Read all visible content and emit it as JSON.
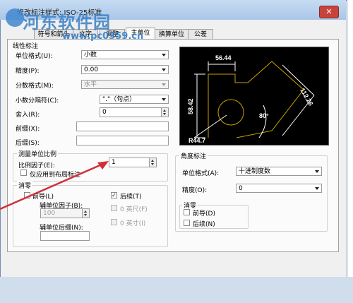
{
  "window": {
    "title": "修改标注样式: ISO-25标准",
    "close_glyph": "✕"
  },
  "watermark": {
    "text": "河东软件园",
    "url": "www.pc0359.cn"
  },
  "tabs": [
    {
      "label": "符号和箭头"
    },
    {
      "label": "文字"
    },
    {
      "label": "调整"
    },
    {
      "label": "主单位",
      "active": true
    },
    {
      "label": "换算单位"
    },
    {
      "label": "公差"
    }
  ],
  "linear": {
    "group_title": "线性标注",
    "unit_format_label": "单位格式(U):",
    "unit_format_value": "小数",
    "precision_label": "精度(P):",
    "precision_value": "0.00",
    "fraction_label": "分数格式(M):",
    "fraction_value": "水平",
    "decimal_sep_label": "小数分隔符(C):",
    "decimal_sep_value": "\".\"（句点）",
    "round_label": "舍入(R):",
    "round_value": "0",
    "prefix_label": "前缀(X):",
    "prefix_value": "",
    "suffix_label": "后缀(S):",
    "suffix_value": ""
  },
  "scale": {
    "group_title": "测量单位比例",
    "factor_label": "比例因子(E):",
    "factor_value": "1",
    "layout_only_label": "仅应用到布局标注",
    "layout_only_checked": false
  },
  "zero": {
    "group_title": "消零",
    "leading_label": "前导(L)",
    "leading_checked": false,
    "trailing_label": "后续(T)",
    "trailing_checked": true,
    "sub_factor_label": "辅单位因子(B):",
    "sub_factor_value": "100",
    "feet_label": "0 英尺(F)",
    "sub_suffix_label": "辅单位后缀(N):",
    "sub_suffix_value": "",
    "inches_label": "0 英寸(I)"
  },
  "preview": {
    "dim_top": "56.44",
    "dim_left": "58.42",
    "dim_diag": "112.26",
    "dim_angle": "80°",
    "dim_radius": "R44.7"
  },
  "angular": {
    "group_title": "角度标注",
    "unit_format_label": "单位格式(A):",
    "unit_format_value": "十进制度数",
    "precision_label": "精度(O):",
    "precision_value": "0",
    "zero_title": "消零",
    "leading_label": "前导(D)",
    "trailing_label": "后续(N)"
  },
  "colors": {
    "title_bg": "#b7cfee",
    "preview_line": "#ffffff",
    "preview_accent": "#c8a000",
    "arrow": "#d0303a"
  }
}
